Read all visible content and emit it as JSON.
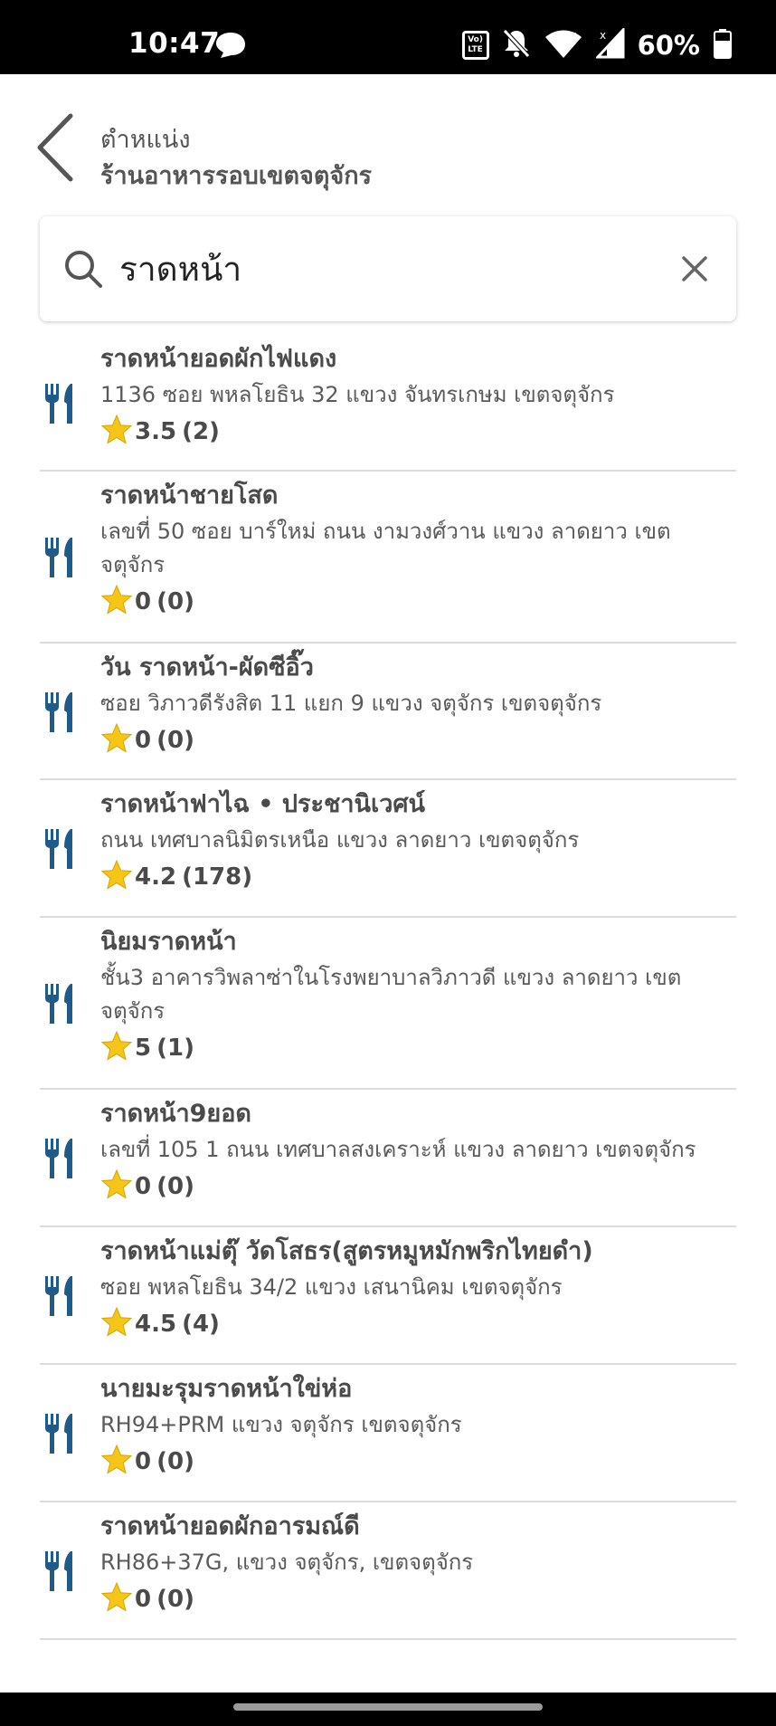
{
  "status_bar": {
    "time": "10:47",
    "battery_percent": "60%",
    "volte_label_top": "Vo)",
    "volte_label_bottom": "LTE",
    "icons": [
      "chat-bubble-icon",
      "volte-icon",
      "mute-icon",
      "wifi-icon",
      "signal-icon",
      "battery-icon"
    ]
  },
  "header": {
    "label": "ตำหแน่ง",
    "title": "ร้านอาหารรอบเขตจตุจักร",
    "back_icon": "chevron-left-icon"
  },
  "search": {
    "value": "ราดหน้า",
    "placeholder": "",
    "search_icon": "search-icon",
    "clear_icon": "close-icon"
  },
  "colors": {
    "accent": "#1e5a8a",
    "star": "#f5c518",
    "divider": "#dcdcdc",
    "text": "#4a4a4a"
  },
  "results": [
    {
      "name": "ราดหน้ายอดผักไฟแดง",
      "address": "1136 ซอย พหลโยธิน 32 แขวง จันทรเกษม เขตจตุจักร",
      "rating": "3.5",
      "count": "(2)",
      "icon": "restaurant-icon"
    },
    {
      "name": "ราดหน้าชายโสด",
      "address": "เลขที่ 50 ซอย บาร์ใหม่ ถนน งามวงศ์วาน แขวง ลาดยาว เขต จตุจักร",
      "rating": "0",
      "count": "(0)",
      "icon": "restaurant-icon"
    },
    {
      "name": "วัน ราดหน้า-ผัดซีอิ๊ว",
      "address": "ซอย วิภาวดีรังสิต 11 แยก 9 แขวง จตุจักร เขตจตุจักร",
      "rating": "0",
      "count": "(0)",
      "icon": "restaurant-icon"
    },
    {
      "name": "ราดหน้าฟาไฉ • ประชานิเวศน์",
      "address": "ถนน เทศบาลนิมิตรเหนือ แขวง ลาดยาว เขตจตุจักร",
      "rating": "4.2",
      "count": "(178)",
      "icon": "restaurant-icon"
    },
    {
      "name": "นิยมราดหน้า",
      "address": "ชั้น3 อาคารวิพลาซ่าในโรงพยาบาลวิภาวดี แขวง ลาดยาว เขต จตุจักร",
      "rating": "5",
      "count": "(1)",
      "icon": "restaurant-icon"
    },
    {
      "name": "ราดหน้า9ยอด",
      "address": "เลขที่ 105 1 ถนน เทศบาลสงเคราะห์ แขวง ลาดยาว เขตจตุจักร",
      "rating": "0",
      "count": "(0)",
      "icon": "restaurant-icon"
    },
    {
      "name": "ราดหน้าแม่ตุ๊ วัดโสธร(สูตรหมูหมักพริกไทยดำ)",
      "address": "ซอย พหลโยธิน 34/2 แขวง เสนานิคม เขตจตุจักร",
      "rating": "4.5",
      "count": "(4)",
      "icon": "restaurant-icon"
    },
    {
      "name": "นายมะรุมราดหน้าใข่ห่อ",
      "address": "RH94+PRM แขวง จตุจักร เขตจตุจักร",
      "rating": "0",
      "count": "(0)",
      "icon": "restaurant-icon"
    },
    {
      "name": "ราดหน้ายอดผักอารมณ์ดี",
      "address": "RH86+37G, แขวง จตุจักร, เขตจตุจักร",
      "rating": "0",
      "count": "(0)",
      "icon": "restaurant-icon"
    }
  ]
}
